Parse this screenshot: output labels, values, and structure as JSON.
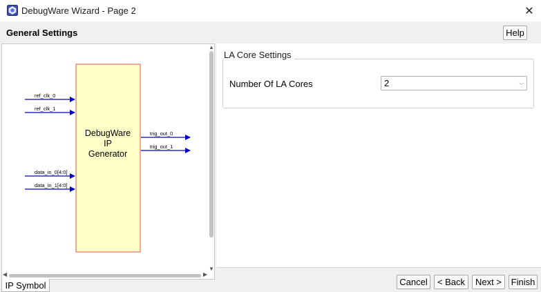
{
  "window": {
    "title": "DebugWare Wizard - Page 2",
    "close_glyph": "✕"
  },
  "header": {
    "section_title": "General Settings",
    "help_label": "Help"
  },
  "ip_symbol": {
    "block_label_lines": [
      "DebugWare",
      "IP",
      "Generator"
    ],
    "inputs": [
      "ref_clk_0",
      "ref_clk_1",
      "data_in_0[4:0]",
      "data_in_1[4:0]"
    ],
    "outputs": [
      "trig_out_0",
      "trig_out_1"
    ],
    "block_fill": "#ffffc8",
    "block_border": "#e05050",
    "signal_color": "#0000cc"
  },
  "tabs": {
    "ip_symbol_label": "IP Symbol"
  },
  "la_core_settings": {
    "group_label": "LA Core Settings",
    "field_label": "Number Of LA Cores",
    "selected_value": "2"
  },
  "footer": {
    "cancel_label": "Cancel",
    "back_label": "< Back",
    "next_label": "Next >",
    "finish_label": "Finish"
  },
  "icons": {
    "app": "debugware-app-icon",
    "close": "close-icon",
    "dropdown": "chevron-down-icon"
  }
}
